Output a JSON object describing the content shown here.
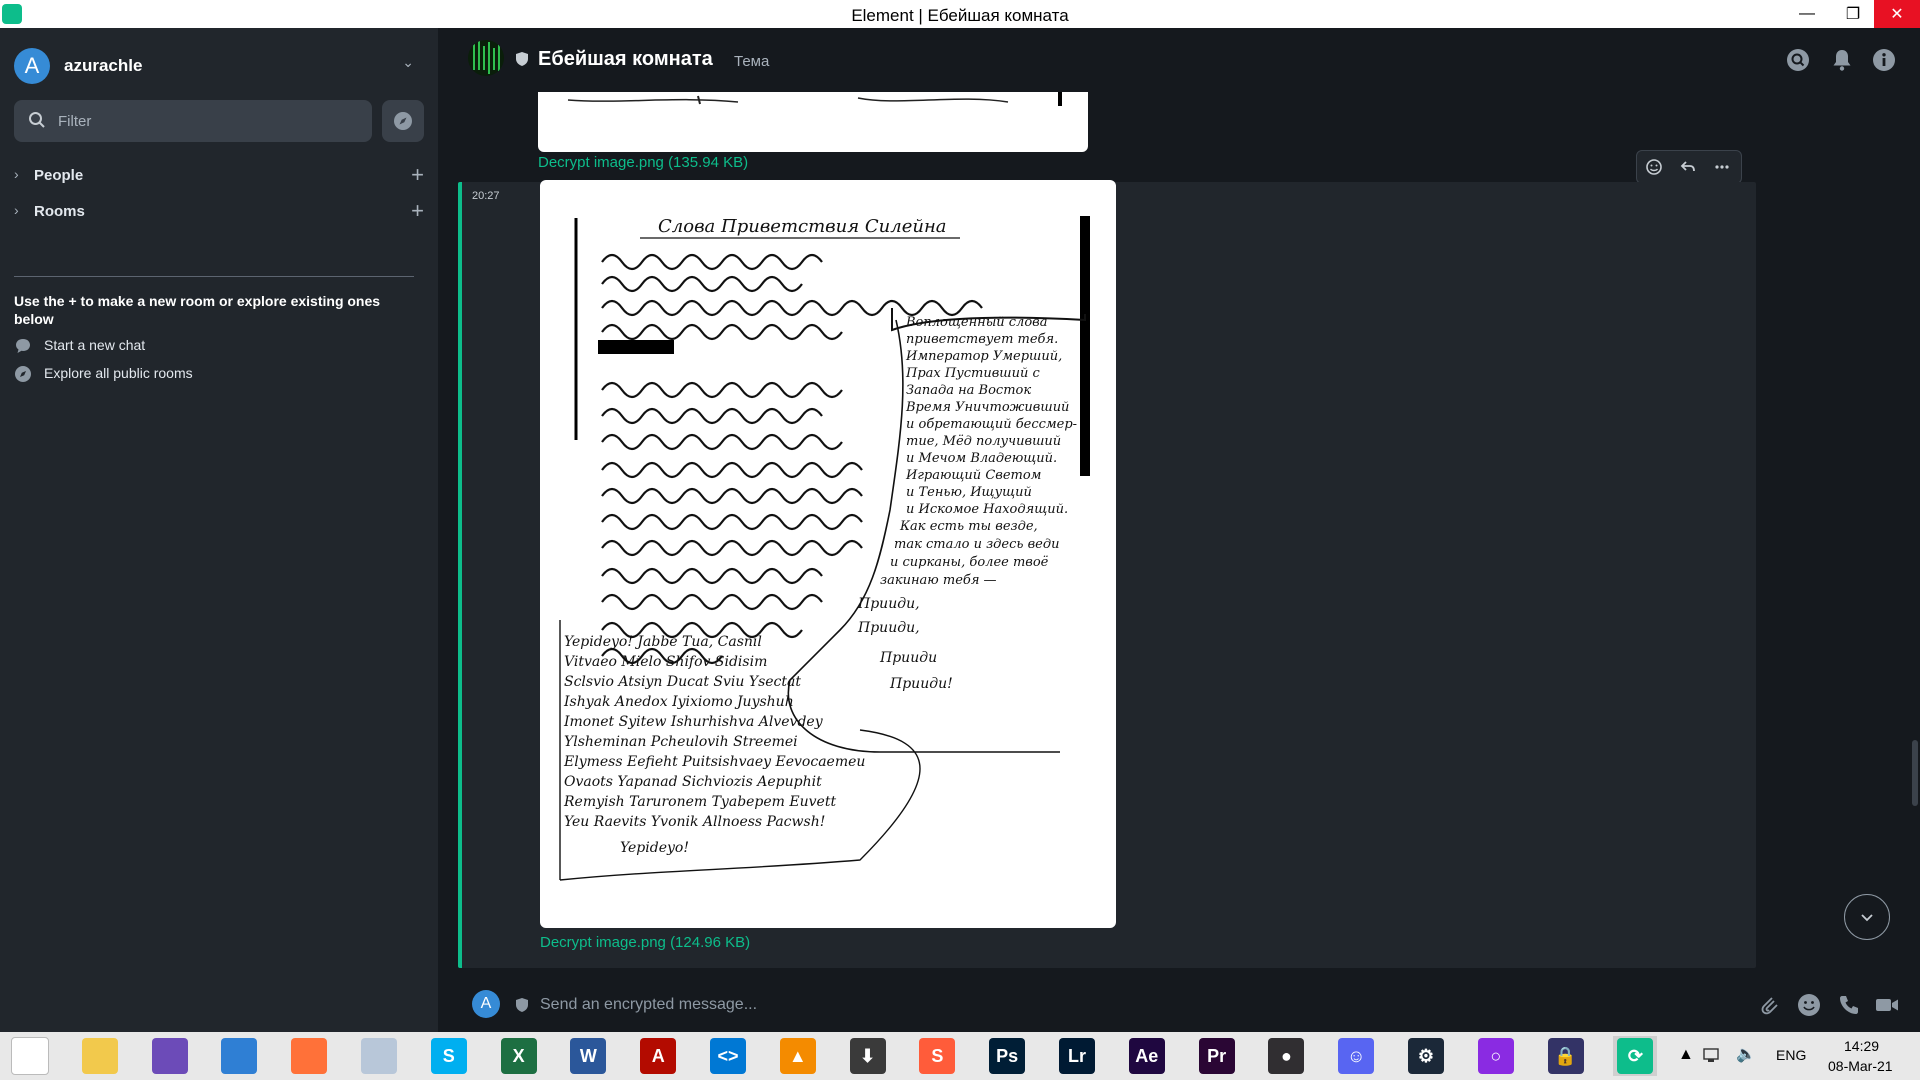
{
  "window": {
    "title": "Element | Ебейшая комната",
    "minimize": "—",
    "restore": "❐",
    "close": "✕"
  },
  "user": {
    "initial": "A",
    "name": "azurachle"
  },
  "filter": {
    "placeholder": "Filter"
  },
  "sidebar": {
    "sections": [
      {
        "label": "People"
      },
      {
        "label": "Rooms"
      }
    ],
    "hint": "Use the + to make a new room or explore existing ones below",
    "links": [
      {
        "label": "Start a new chat",
        "icon": "chat-bubble-icon"
      },
      {
        "label": "Explore all public rooms",
        "icon": "compass-icon"
      }
    ]
  },
  "room": {
    "name": "Ебейшая комната",
    "topic": "Тема"
  },
  "timeline": {
    "prev_file": "Decrypt image.png (135.94 KB)",
    "event": {
      "time": "20:27",
      "file": "Decrypt image.png (124.96 KB)"
    },
    "image_text": {
      "heading": "Слова Приветствия Силейна",
      "latin_lines": [
        "Yepideyo! Jabbe Tua, Casnil",
        "Vitvaeo Mielo Shifov Sidisim",
        "Sclsvio Atsiyn Ducat Sviu Ysectat",
        "Ishyak Anedox Iyixiomo Juyshuh",
        "Imonet Syitew Ishurhishva Alvevdey",
        "Ylsheminan Pcheulovih Streemei",
        "Elymess Eefieht Puitsishvaey Eevocaemeu",
        "Ovaots Yapanad Sichviozis Aepuphit",
        "Remyish Taruronem Tyabepem Euvett",
        "Yeu Raevits Yvonik Allnoess Pacwsh!",
        "Yepideyo!"
      ],
      "russian_lines": [
        "Воплощенный слова",
        "приветствует тебя.",
        "Император Умерший,",
        "Прах Пустивший с",
        "Запада на Восток",
        "Время Уничтоживший",
        "и обретающий бессмер-",
        "тие, Мёд получивший",
        "и Мечом Владеющий.",
        "Играющий Светом",
        "и Тенью, Ищущий",
        "и Искомое Находящий.",
        "Как есть ты везде,",
        "так стало и здесь веди",
        "и сирканы, более твоё",
        "закинаю тебя —",
        "Прииди,",
        "Прииди,",
        "Прииди",
        "Прииди!"
      ]
    }
  },
  "composer": {
    "placeholder": "Send an encrypted message...",
    "avatar_initial": "A"
  },
  "taskbar": {
    "apps": [
      {
        "icon": "windows-start-icon",
        "label": "",
        "color": "#ffffff"
      },
      {
        "icon": "file-explorer-icon",
        "label": "",
        "color": "#f2c94c"
      },
      {
        "icon": "torrent-icon",
        "label": "",
        "color": "#6c4bb8"
      },
      {
        "icon": "browser-globe-icon",
        "label": "",
        "color": "#2f7fd4"
      },
      {
        "icon": "firefox-icon",
        "label": "",
        "color": "#ff7139"
      },
      {
        "icon": "moon-app-icon",
        "label": "",
        "color": "#b8c7d9"
      },
      {
        "icon": "skype-icon",
        "label": "S",
        "color": "#00aff0"
      },
      {
        "icon": "excel-icon",
        "label": "X",
        "color": "#1d6f42"
      },
      {
        "icon": "word-icon",
        "label": "W",
        "color": "#2b579a"
      },
      {
        "icon": "acrobat-icon",
        "label": "A",
        "color": "#b30b00"
      },
      {
        "icon": "vscode-icon",
        "label": "<>",
        "color": "#0078d4"
      },
      {
        "icon": "vlc-icon",
        "label": "▲",
        "color": "#f48b00"
      },
      {
        "icon": "download-manager-icon",
        "label": "⬇",
        "color": "#3a3a3a"
      },
      {
        "icon": "sublime-icon",
        "label": "S",
        "color": "#ff5c3a"
      },
      {
        "icon": "photoshop-icon",
        "label": "Ps",
        "color": "#001e36"
      },
      {
        "icon": "lightroom-icon",
        "label": "Lr",
        "color": "#001a33"
      },
      {
        "icon": "after-effects-icon",
        "label": "Ae",
        "color": "#1f0740"
      },
      {
        "icon": "premiere-icon",
        "label": "Pr",
        "color": "#2a0634"
      },
      {
        "icon": "obs-icon",
        "label": "●",
        "color": "#302e31"
      },
      {
        "icon": "discord-icon",
        "label": "☺",
        "color": "#5865f2"
      },
      {
        "icon": "steam-icon",
        "label": "⚙",
        "color": "#1b2838"
      },
      {
        "icon": "ring-app-icon",
        "label": "○",
        "color": "#8a2be2"
      },
      {
        "icon": "vpn-lock-icon",
        "label": "🔒",
        "color": "#333366"
      },
      {
        "icon": "element-icon",
        "label": "⟳",
        "color": "#0dbd8b"
      }
    ],
    "tray": {
      "language": "ENG",
      "time": "14:29",
      "date": "08-Mar-21"
    }
  }
}
